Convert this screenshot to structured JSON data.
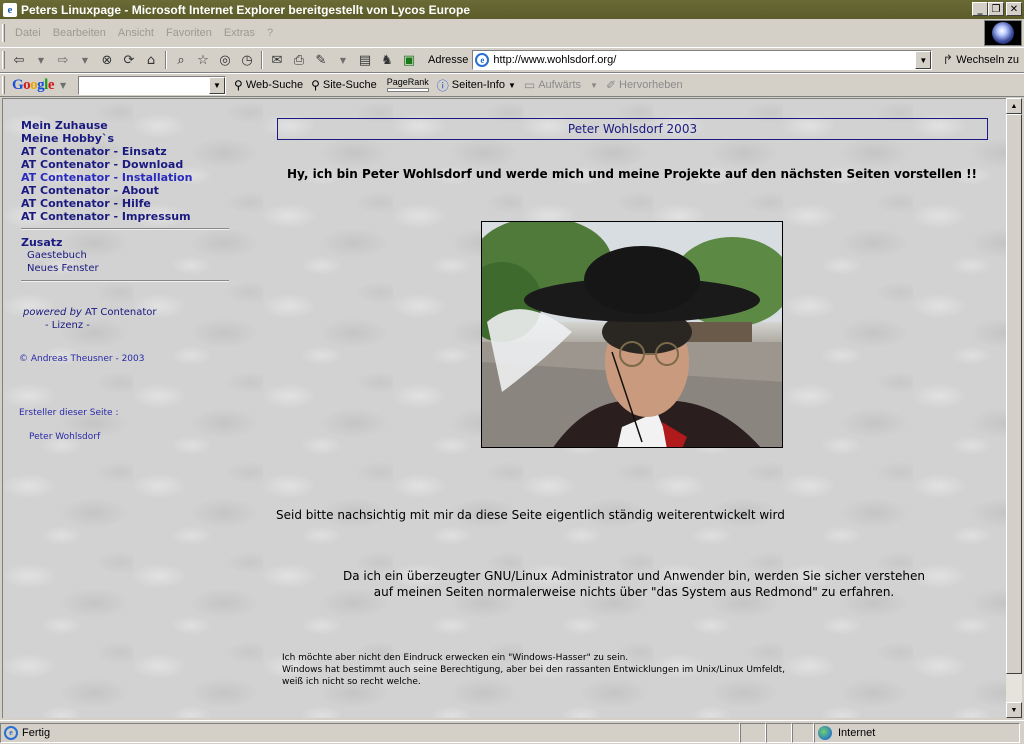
{
  "window": {
    "title": "Peters Linuxpage - Microsoft Internet Explorer bereitgestellt von Lycos Europe"
  },
  "menu": [
    "Datei",
    "Bearbeiten",
    "Ansicht",
    "Favoriten",
    "Extras",
    "?"
  ],
  "toolbar": {
    "address_label": "Adresse",
    "address_value": "http://www.wohlsdorf.org/",
    "goto_label": "Wechseln zu"
  },
  "google_bar": {
    "logo": "Google",
    "search_value": "",
    "web_search": "Web-Suche",
    "site_search": "Site-Suche",
    "pagerank": "PageRank",
    "page_info": "Seiten-Info",
    "up": "Aufwärts",
    "highlight": "Hervorheben"
  },
  "page": {
    "nav": [
      "Mein Zuhause",
      "Meine Hobby`s",
      "AT Contenator - Einsatz",
      "AT Contenator - Download",
      "AT Contenator - Installation",
      "AT Contenator - About",
      "AT Contenator - Hilfe",
      "AT Contenator - Impressum"
    ],
    "zusatz_label": "Zusatz",
    "zusatz_links": [
      "Gaestebuch",
      "Neues Fenster"
    ],
    "powered_prefix": "powered by",
    "powered_name": "AT Contenator",
    "license": "- Lizenz -",
    "copyright": "© Andreas Theusner - 2003",
    "creator_label": "Ersteller dieser Seite :",
    "creator_name": "Peter Wohlsdorf",
    "header": "Peter Wohlsdorf 2003",
    "intro": "Hy, ich bin Peter Wohlsdorf und werde mich und meine Projekte auf den nächsten Seiten vorstellen !!",
    "para1": "Seid bitte nachsichtig mit mir da diese Seite eigentlich ständig weiterentwickelt wird",
    "para2_line1": "Da ich ein überzeugter GNU/Linux Administrator und Anwender bin, werden Sie sicher verstehen",
    "para2_line2": "auf meinen Seiten normalerweise nichts über \"das System aus Redmond\" zu erfahren.",
    "para3_line1": "Ich möchte aber nicht den Eindruck erwecken ein \"Windows-Hasser\" zu sein.",
    "para3_line2": "Windows hat bestimmt auch seine Berechtigung, aber bei den rassanten Entwicklungen im Unix/Linux Umfeldt,",
    "para3_line3": "weiß ich nicht so recht welche."
  },
  "status": {
    "text": "Fertig",
    "zone": "Internet"
  },
  "colors": {
    "title_bar": "#5c5c2a",
    "link": "#1a1a80",
    "chrome": "#d4d0c8"
  }
}
